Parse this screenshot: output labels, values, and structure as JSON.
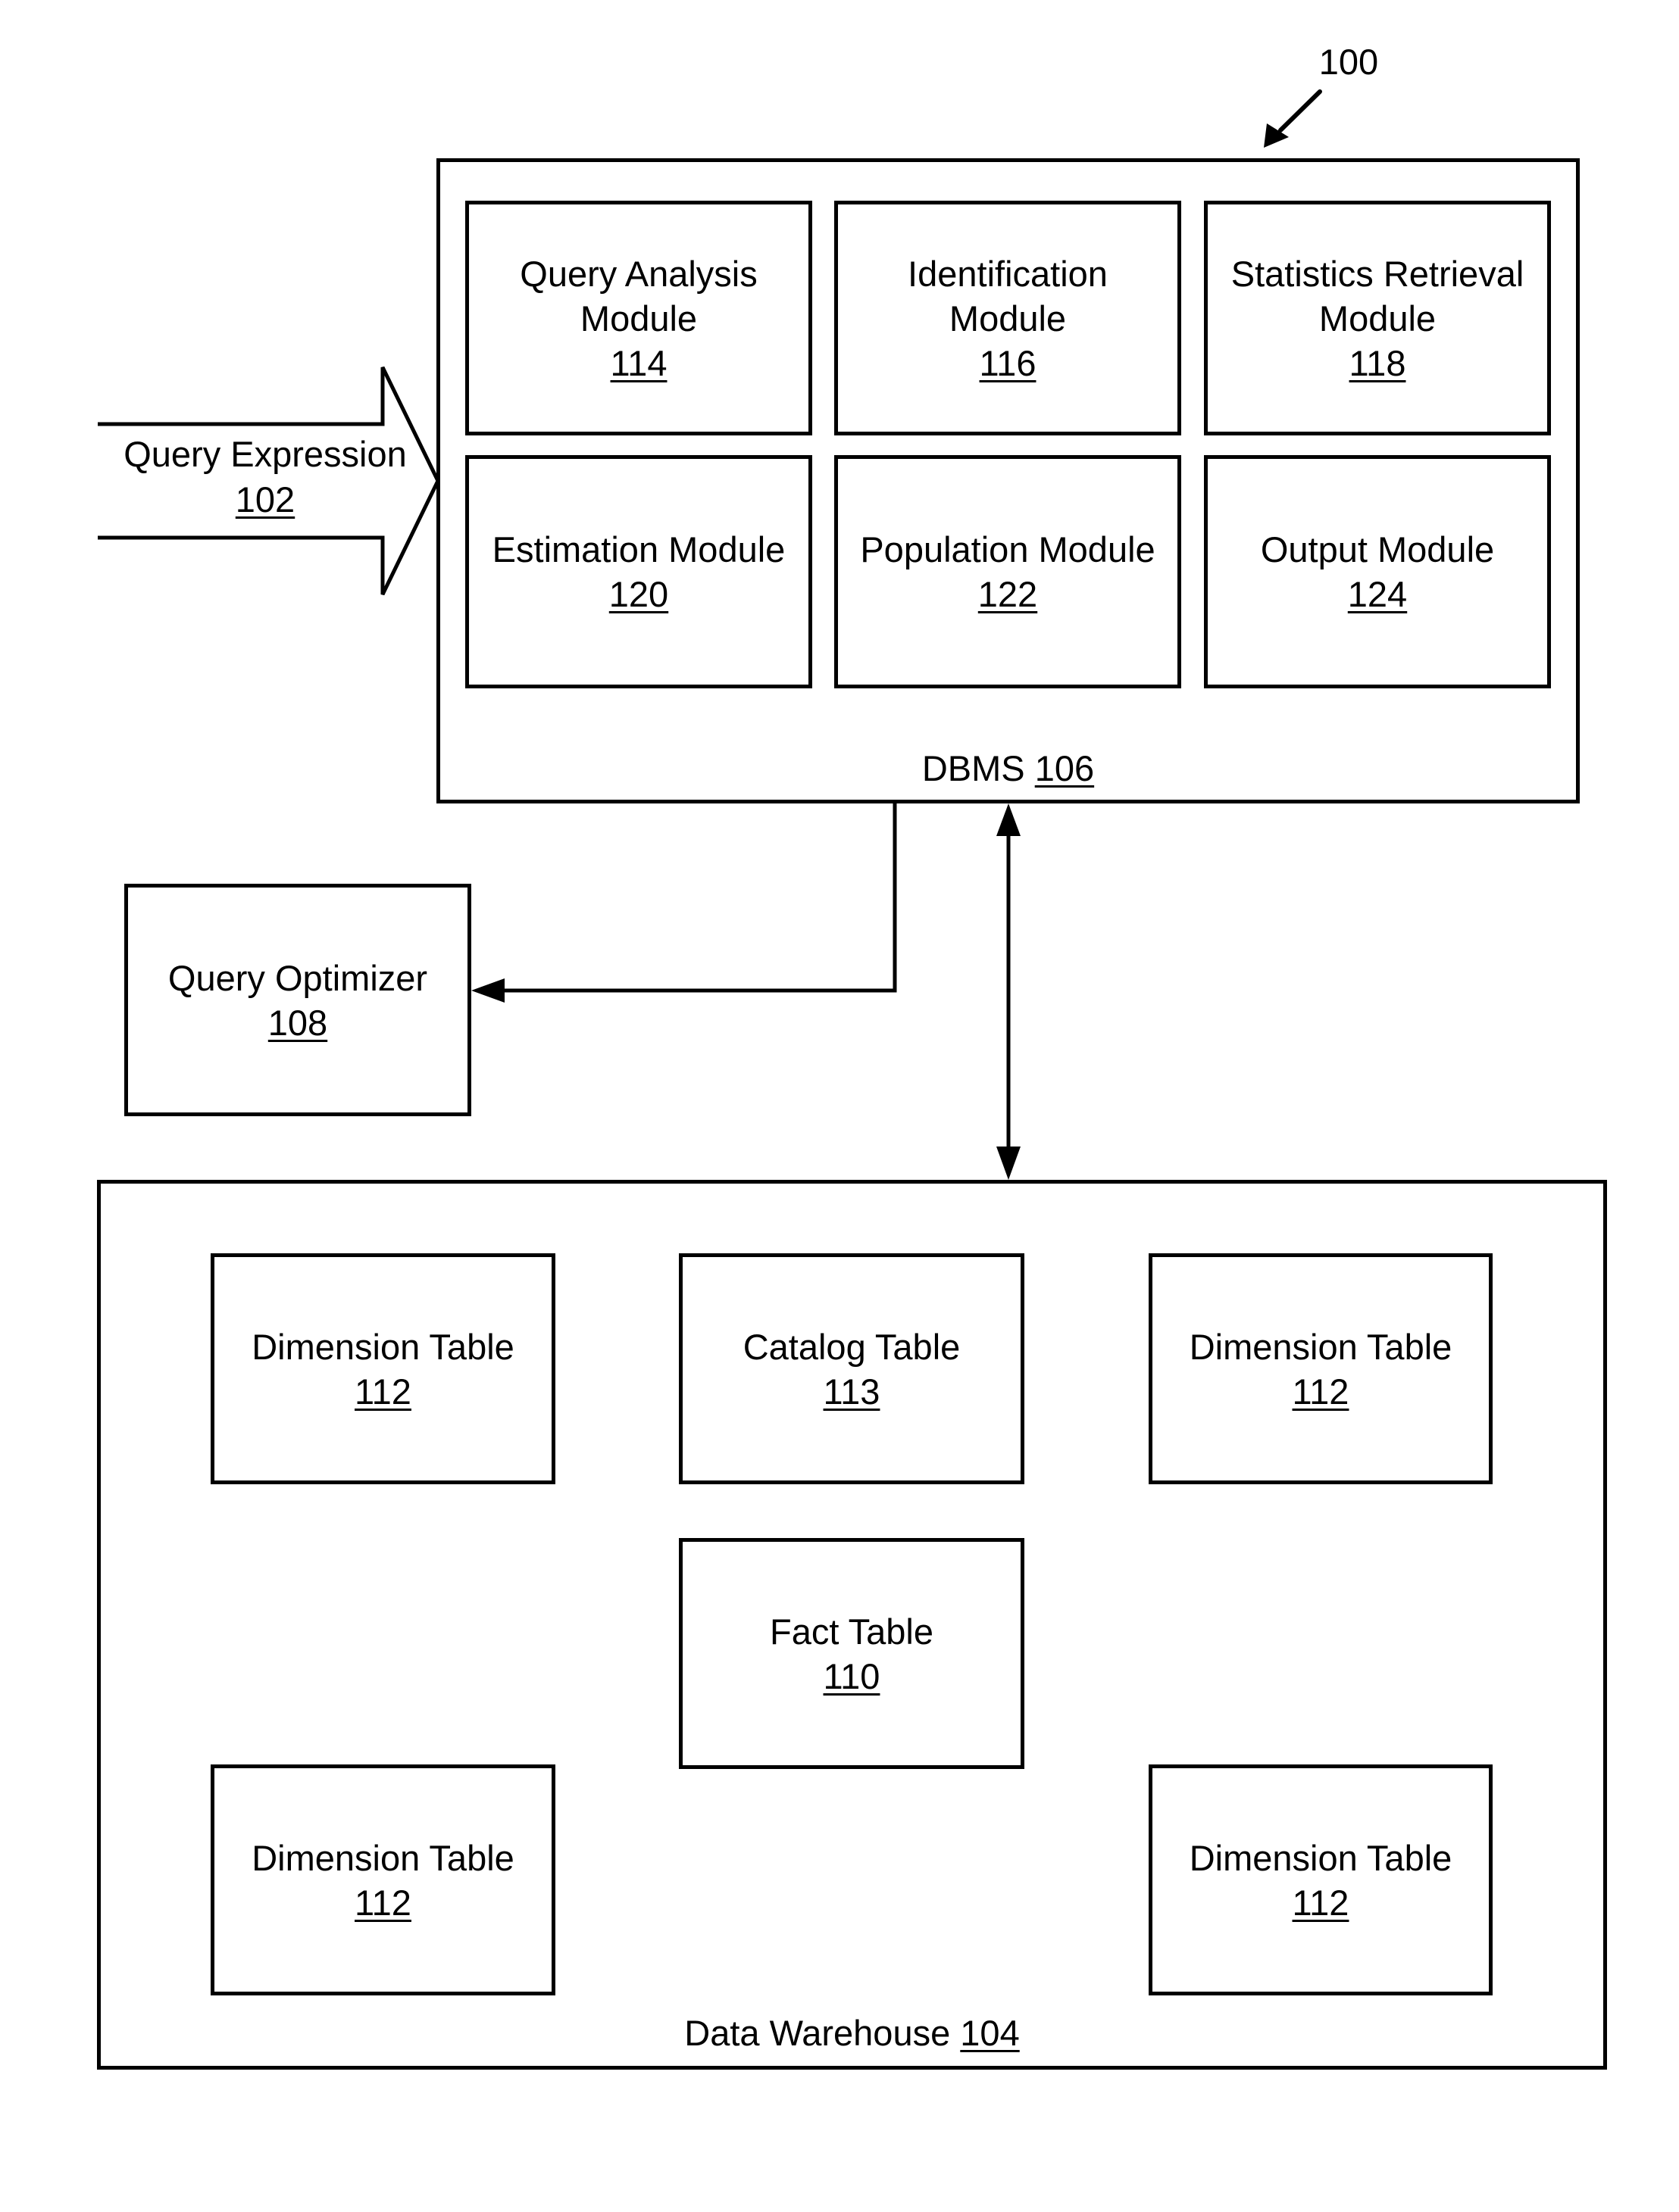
{
  "figure": {
    "reference": "100"
  },
  "query_expression": {
    "label": "Query Expression",
    "number": "102"
  },
  "dbms": {
    "label": "DBMS",
    "number": "106",
    "modules": [
      {
        "label": "Query Analysis\nModule",
        "number": "114"
      },
      {
        "label": "Identification\nModule",
        "number": "116"
      },
      {
        "label": "Statistics Retrieval\nModule",
        "number": "118"
      },
      {
        "label": "Estimation Module",
        "number": "120"
      },
      {
        "label": "Population Module",
        "number": "122"
      },
      {
        "label": "Output Module",
        "number": "124"
      }
    ]
  },
  "query_optimizer": {
    "label": "Query Optimizer",
    "number": "108"
  },
  "data_warehouse": {
    "label": "Data Warehouse",
    "number": "104",
    "tables": [
      {
        "label": "Dimension Table",
        "number": "112"
      },
      {
        "label": "Catalog Table",
        "number": "113"
      },
      {
        "label": "Dimension Table",
        "number": "112"
      },
      {
        "label": "Fact Table",
        "number": "110"
      },
      {
        "label": "Dimension Table",
        "number": "112"
      },
      {
        "label": "Dimension Table",
        "number": "112"
      }
    ]
  },
  "colors": {
    "stroke": "#000000",
    "background": "#ffffff"
  }
}
